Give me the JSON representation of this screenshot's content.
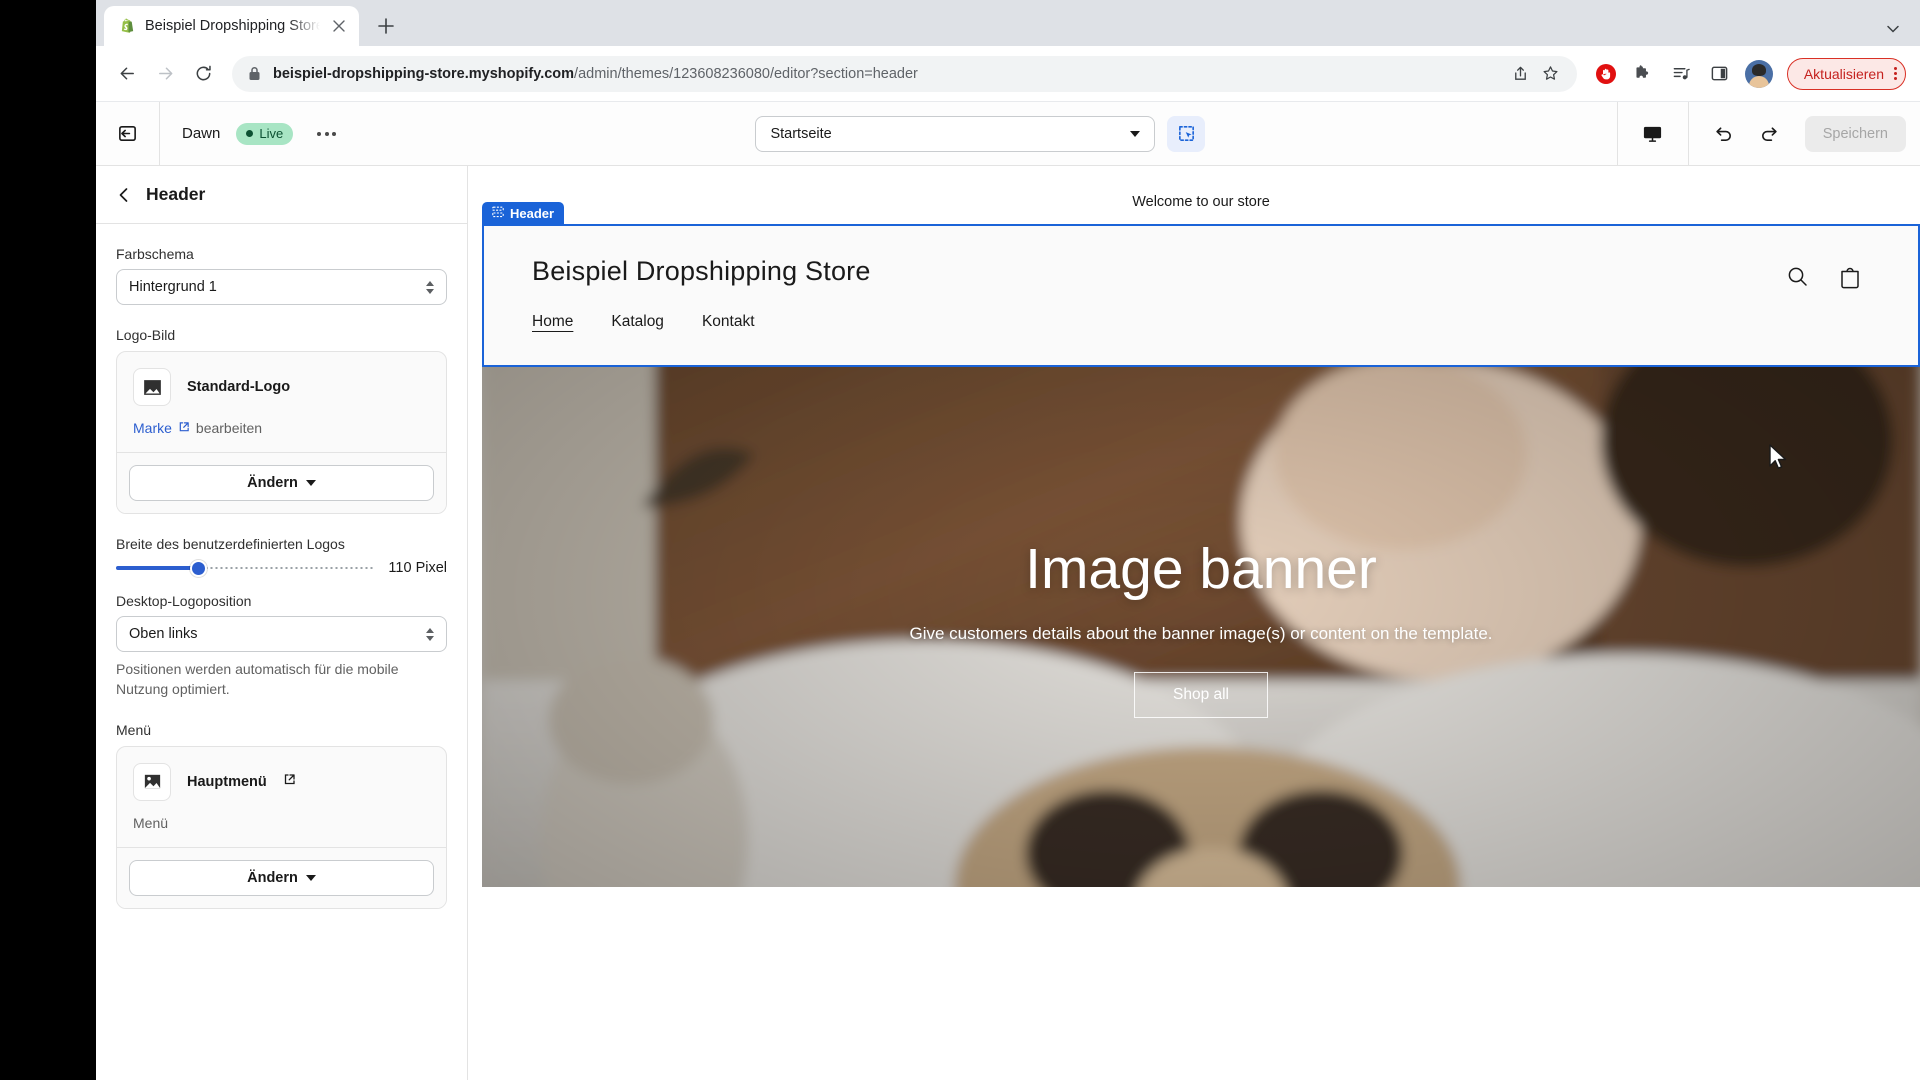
{
  "browser": {
    "tab": {
      "title": "Beispiel Dropshipping Store · D",
      "favicon": "shopify-icon",
      "close": "×"
    },
    "newtab_label": "+",
    "url_domain": "beispiel-dropshipping-store.myshopify.com",
    "url_path": "/admin/themes/123608236080/editor?section=header",
    "update_button": "Aktualisieren"
  },
  "editor": {
    "theme_name": "Dawn",
    "live_badge": "Live",
    "page_selector": "Startseite",
    "save_button": "Speichern"
  },
  "sidebar": {
    "title": "Header",
    "color_scheme_label": "Farbschema",
    "color_scheme_value": "Hintergrund 1",
    "logo_image_label": "Logo-Bild",
    "logo_name": "Standard-Logo",
    "brand_link": "Marke",
    "brand_edit": "bearbeiten",
    "change_button": "Ändern",
    "logo_width_label": "Breite des benutzerdefinierten Logos",
    "logo_width_value": "110 Pixel",
    "logo_width_percent": 32,
    "logo_position_label": "Desktop-Logoposition",
    "logo_position_value": "Oben links",
    "logo_position_help": "Positionen werden automatisch für die mobile Nutzung optimiert.",
    "menu_label": "Menü",
    "menu_name": "Hauptmenü",
    "menu_sub": "Menü",
    "menu_change_button": "Ändern"
  },
  "preview": {
    "section_badge": "Header",
    "announcement": "Welcome to our store",
    "store_name": "Beispiel Dropshipping Store",
    "nav": [
      {
        "label": "Home",
        "active": true
      },
      {
        "label": "Katalog",
        "active": false
      },
      {
        "label": "Kontakt",
        "active": false
      }
    ],
    "banner_heading": "Image banner",
    "banner_text": "Give customers details about the banner image(s) or content on the template.",
    "banner_button": "Shop all"
  },
  "colors": {
    "shopify_blue": "#1a63d8",
    "live_green": "#a8e5c4",
    "slider_blue": "#2c5ecf",
    "update_red": "#c5221f"
  }
}
